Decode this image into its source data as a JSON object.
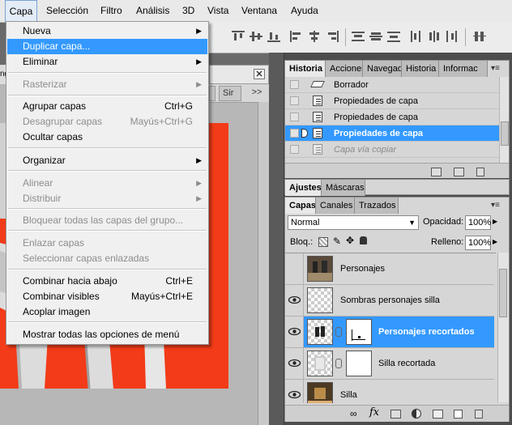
{
  "menubar": {
    "items": [
      {
        "label": "Capa"
      },
      {
        "label": "Selección"
      },
      {
        "label": "Filtro"
      },
      {
        "label": "Análisis"
      },
      {
        "label": "3D"
      },
      {
        "label": "Vista"
      },
      {
        "label": "Ventana"
      },
      {
        "label": "Ayuda"
      }
    ]
  },
  "menu": {
    "items": [
      {
        "label": "Nueva",
        "shortcut": "",
        "submenu": true,
        "disabled": false,
        "highlighted": false
      },
      {
        "label": "Duplicar capa...",
        "shortcut": "",
        "submenu": false,
        "disabled": false,
        "highlighted": true
      },
      {
        "label": "Eliminar",
        "shortcut": "",
        "submenu": true,
        "disabled": false,
        "highlighted": false
      },
      {
        "label": "Rasterizar",
        "shortcut": "",
        "submenu": true,
        "disabled": true,
        "highlighted": false
      },
      {
        "label": "Agrupar capas",
        "shortcut": "Ctrl+G",
        "submenu": false,
        "disabled": false,
        "highlighted": false
      },
      {
        "label": "Desagrupar capas",
        "shortcut": "Mayús+Ctrl+G",
        "submenu": false,
        "disabled": true,
        "highlighted": false
      },
      {
        "label": "Ocultar capas",
        "shortcut": "",
        "submenu": false,
        "disabled": false,
        "highlighted": false
      },
      {
        "label": "Organizar",
        "shortcut": "",
        "submenu": true,
        "disabled": false,
        "highlighted": false
      },
      {
        "label": "Alinear",
        "shortcut": "",
        "submenu": true,
        "disabled": true,
        "highlighted": false
      },
      {
        "label": "Distribuir",
        "shortcut": "",
        "submenu": true,
        "disabled": true,
        "highlighted": false
      },
      {
        "label": "Bloquear todas las capas del grupo...",
        "shortcut": "",
        "submenu": false,
        "disabled": true,
        "highlighted": false
      },
      {
        "label": "Enlazar capas",
        "shortcut": "",
        "submenu": false,
        "disabled": true,
        "highlighted": false
      },
      {
        "label": "Seleccionar capas enlazadas",
        "shortcut": "",
        "submenu": false,
        "disabled": true,
        "highlighted": false
      },
      {
        "label": "Combinar hacia abajo",
        "shortcut": "Ctrl+E",
        "submenu": false,
        "disabled": false,
        "highlighted": false
      },
      {
        "label": "Combinar visibles",
        "shortcut": "Mayús+Ctrl+E",
        "submenu": false,
        "disabled": false,
        "highlighted": false
      },
      {
        "label": "Acoplar imagen",
        "shortcut": "",
        "submenu": false,
        "disabled": false,
        "highlighted": false
      },
      {
        "label": "Mostrar todas las opciones de menú",
        "shortcut": "",
        "submenu": false,
        "disabled": false,
        "highlighted": false
      }
    ]
  },
  "docwin": {
    "tab_partial": "Sir",
    "overflow": ">>",
    "left_partial": "ng"
  },
  "history_panel": {
    "tabs": [
      "Historia",
      "Acciones",
      "Navegad",
      "Historia",
      "Informac"
    ],
    "rows": [
      {
        "label": "Borrador",
        "icon": "eraser-icon",
        "selected": false,
        "ghost": false
      },
      {
        "label": "Propiedades de capa",
        "icon": "document-icon",
        "selected": false,
        "ghost": false
      },
      {
        "label": "Propiedades de capa",
        "icon": "document-icon",
        "selected": false,
        "ghost": false
      },
      {
        "label": "Propiedades de capa",
        "icon": "document-icon",
        "selected": true,
        "ghost": false
      },
      {
        "label": "Capa vía copiar",
        "icon": "document-icon",
        "selected": false,
        "ghost": true
      }
    ]
  },
  "adjust_panel": {
    "tabs": [
      "Ajustes",
      "Máscaras"
    ]
  },
  "layers_panel": {
    "tabs": [
      "Capas",
      "Canales",
      "Trazados"
    ],
    "blend_mode": "Normal",
    "opacity_label": "Opacidad:",
    "opacity_value": "100%",
    "lock_label": "Bloq.:",
    "fill_label": "Relleno:",
    "fill_value": "100%",
    "layers": [
      {
        "name": "Personajes",
        "visible": false,
        "selected": false,
        "has_mask": false
      },
      {
        "name": "Sombras personajes silla",
        "visible": true,
        "selected": false,
        "has_mask": false
      },
      {
        "name": "Personajes recortados",
        "visible": true,
        "selected": true,
        "has_mask": true
      },
      {
        "name": "Silla recortada",
        "visible": true,
        "selected": false,
        "has_mask": true
      },
      {
        "name": "Silla",
        "visible": true,
        "selected": false,
        "has_mask": false
      }
    ]
  },
  "colors": {
    "highlight": "#3399ff",
    "canvas_red": "#f23b18"
  }
}
